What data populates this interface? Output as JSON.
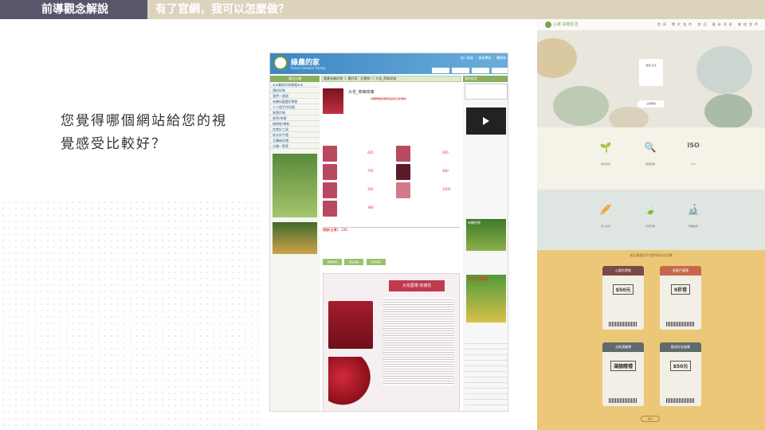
{
  "header": {
    "section_label": "前導觀念解說",
    "slide_title": "有了官網，我可以怎麼做？"
  },
  "question": {
    "line1": "您覺得哪個網站給您的視",
    "line2": "覺感受比較好？"
  },
  "left_site": {
    "name": "綠農的家",
    "sub": "Green Farmers Family",
    "top_links": "加入會員 ｜ 會員專區 ｜ 購物車",
    "sidebar_head": "產品分類",
    "sidebar_items": [
      "★★最新好料報報★★",
      "頭份好物",
      "我們—銷園",
      "有機&優選好果物",
      "十八般手作料理",
      "果蔬作物",
      "香草/茶類",
      "綠餅乾/果乾",
      "良食好工具",
      "各式伴手禮",
      "又購新好禮",
      "分類一覽表"
    ],
    "breadcrumb": "農產有機好物 ＞ 農好家：好農物 ＞ 大花_荷梅玫瑰",
    "product_title": "大花_荷梅玫瑰",
    "product_note": "（週期營購含量限定提供訂單/購物）",
    "prices": [
      "420",
      "600",
      "750",
      "460",
      "350",
      "1200",
      "380"
    ],
    "total": "總額(含運)：120",
    "tabs": [
      "購物說明",
      "農夫故事",
      "交流好康"
    ],
    "banner_title": "大花農場‧玫瑰花",
    "right_head": "我的設定",
    "right_head2": "商品搜尋",
    "ad_label": "有機好物",
    "ad_label2": "天天七菜單"
  },
  "right_site": {
    "logo": "心家 好物生活",
    "menu": "首頁 關於我們 商品 最新消息 聯絡我們",
    "hero_card": "優選 生活",
    "hero_button": "立即購買",
    "features1": [
      "產地直送",
      "嚴選把關",
      "ISO"
    ],
    "features2": [
      "安心食材",
      "天然有機",
      "專業檢驗"
    ],
    "coupon_title": "新品優惠好評‧我們的好友回饋",
    "coupons": [
      {
        "head": "心愛折價卷",
        "big": "$50元",
        "color": "#7a4a46"
      },
      {
        "head": "老客戶優惠",
        "big": "9折卷",
        "color": "#c7684a"
      },
      {
        "head": "全新滿額禮",
        "big": "滿額贈禮",
        "color": "#5f6a6c"
      },
      {
        "head": "歡迎好友推薦",
        "big": "$50元",
        "color": "#5f6a6c"
      }
    ],
    "more": "更多"
  }
}
